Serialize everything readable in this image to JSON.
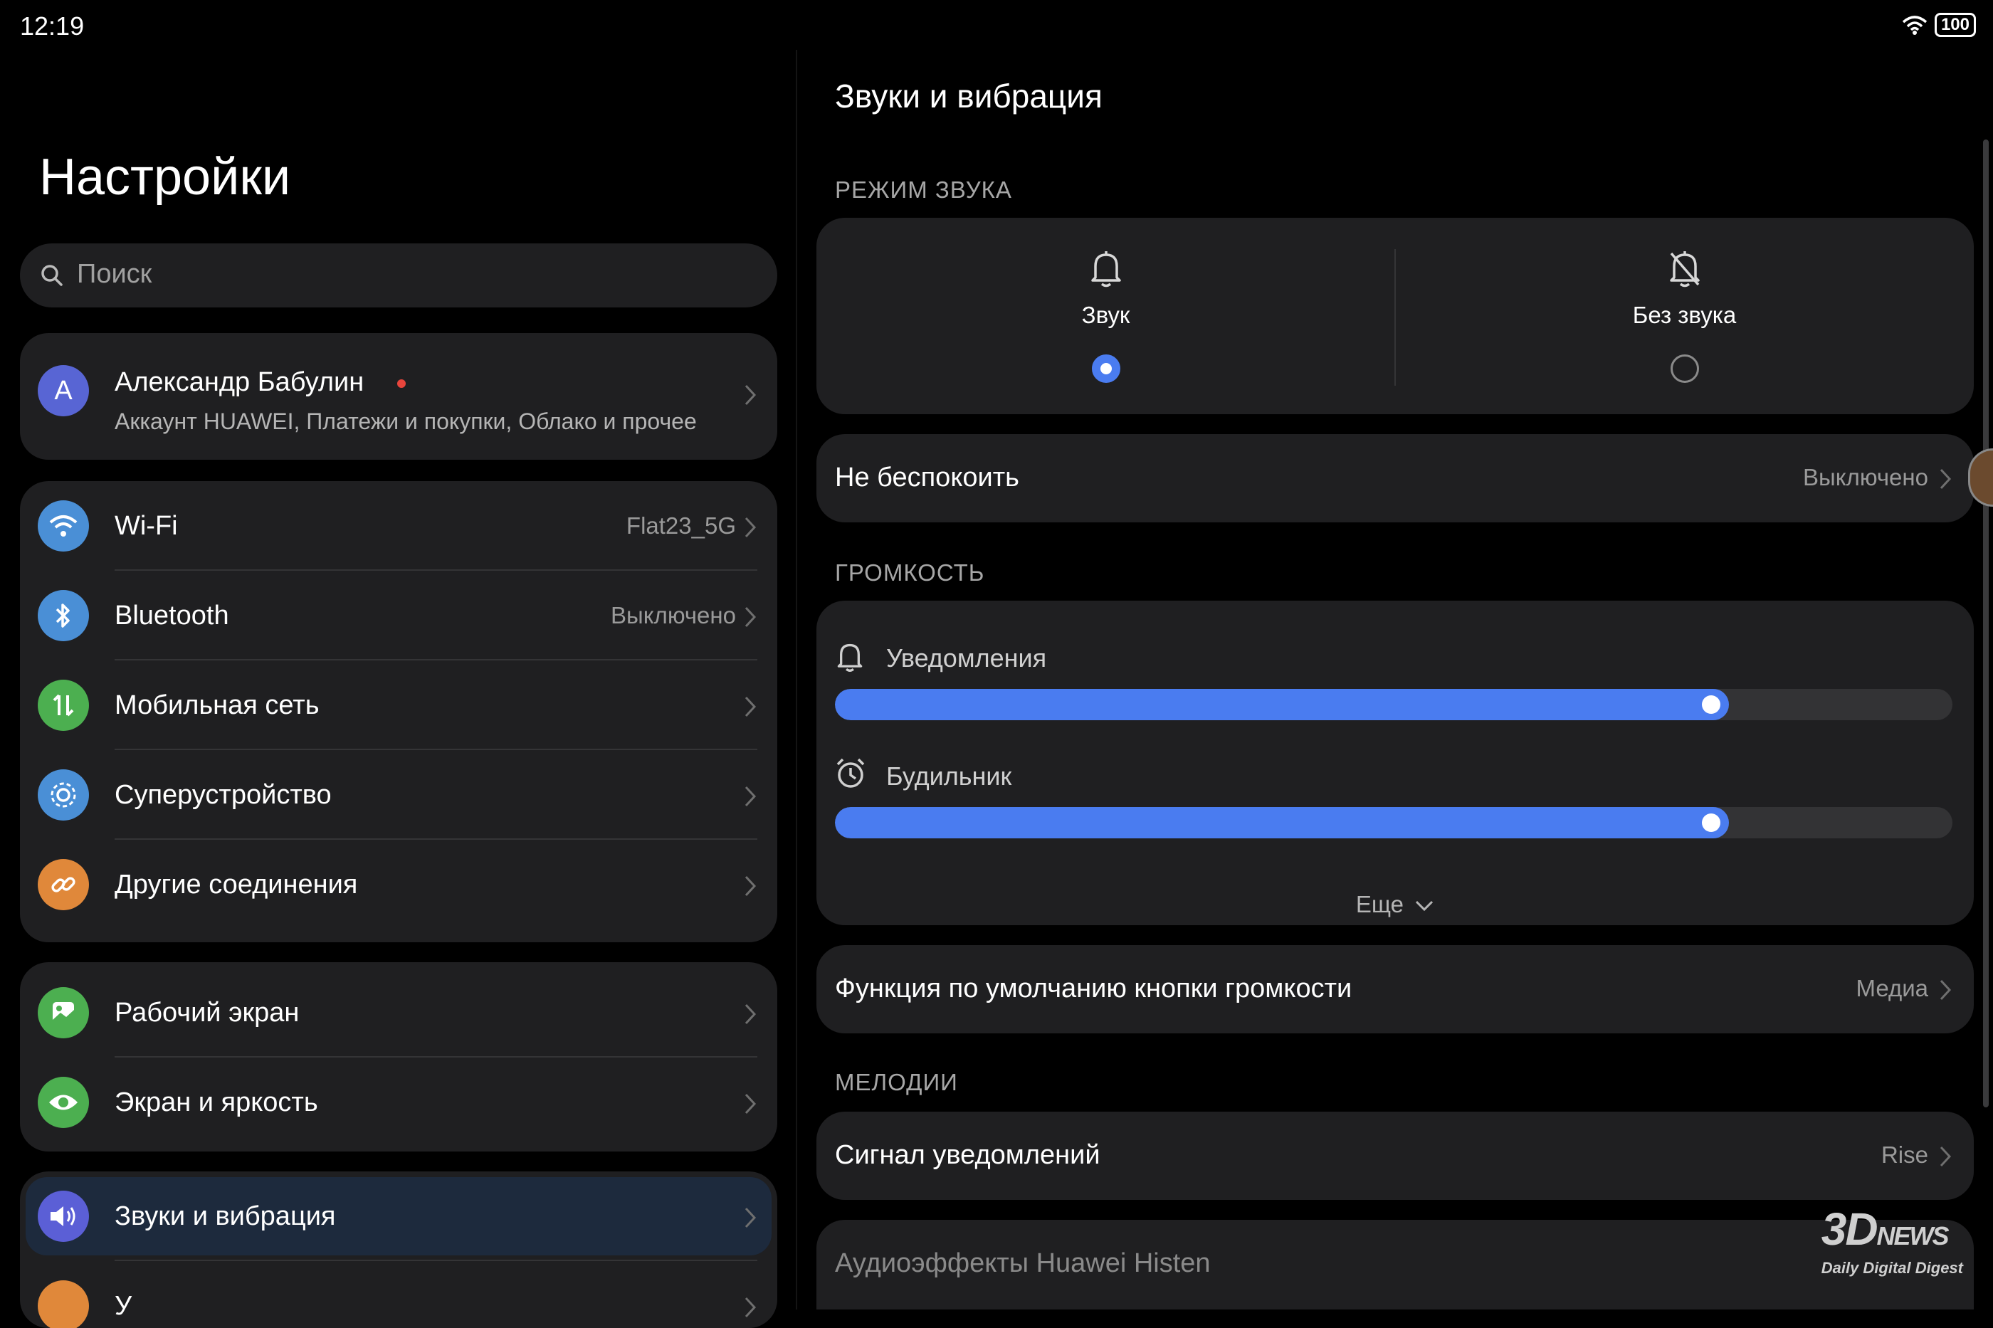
{
  "status": {
    "time": "12:19",
    "battery": "100"
  },
  "left": {
    "title": "Настройки",
    "search_placeholder": "Поиск",
    "account": {
      "avatar": "А",
      "name": "Александр Бабулин",
      "subtitle": "Аккаунт HUAWEI, Платежи и покупки, Облако и прочее"
    },
    "network": [
      {
        "label": "Wi-Fi",
        "value": "Flat23_5G",
        "icon": "wifi-icon",
        "color": "#4a8fd6"
      },
      {
        "label": "Bluetooth",
        "value": "Выключено",
        "icon": "bluetooth-icon",
        "color": "#4a8fd6"
      },
      {
        "label": "Мобильная сеть",
        "value": "",
        "icon": "mobile-data-icon",
        "color": "#4caf50"
      },
      {
        "label": "Суперустройство",
        "value": "",
        "icon": "super-device-icon",
        "color": "#4a8fd6"
      },
      {
        "label": "Другие соединения",
        "value": "",
        "icon": "link-icon",
        "color": "#e0883a"
      }
    ],
    "display": [
      {
        "label": "Рабочий экран",
        "icon": "home-screen-icon",
        "color": "#4caf50"
      },
      {
        "label": "Экран и яркость",
        "icon": "eye-icon",
        "color": "#4caf50"
      }
    ],
    "sound": {
      "label": "Звуки и вибрация",
      "icon": "speaker-icon",
      "color": "#5b5fd6",
      "next_label": "У"
    }
  },
  "right": {
    "title": "Звуки и вибрация",
    "section_mode": "РЕЖИМ ЗВУКА",
    "mode_sound": "Звук",
    "mode_silent": "Без звука",
    "mode_selected": "sound",
    "dnd": {
      "label": "Не беспокоить",
      "value": "Выключено"
    },
    "section_volume": "ГРОМКОСТЬ",
    "volume": [
      {
        "label": "Уведомления",
        "level": 0.8
      },
      {
        "label": "Будильник",
        "level": 0.8
      }
    ],
    "more": "Еще",
    "volume_button": {
      "label": "Функция по умолчанию кнопки громкости",
      "value": "Медиа"
    },
    "section_melodies": "МЕЛОДИИ",
    "notification_tone": {
      "label": "Сигнал уведомлений",
      "value": "Rise"
    },
    "audio_effects": {
      "label": "Аудиоэффекты Huawei Histen"
    }
  },
  "watermark": {
    "brand": "3D",
    "brand_suffix": "NEWS",
    "tagline": "Daily Digital Digest"
  },
  "accent": "#4a7cf0"
}
